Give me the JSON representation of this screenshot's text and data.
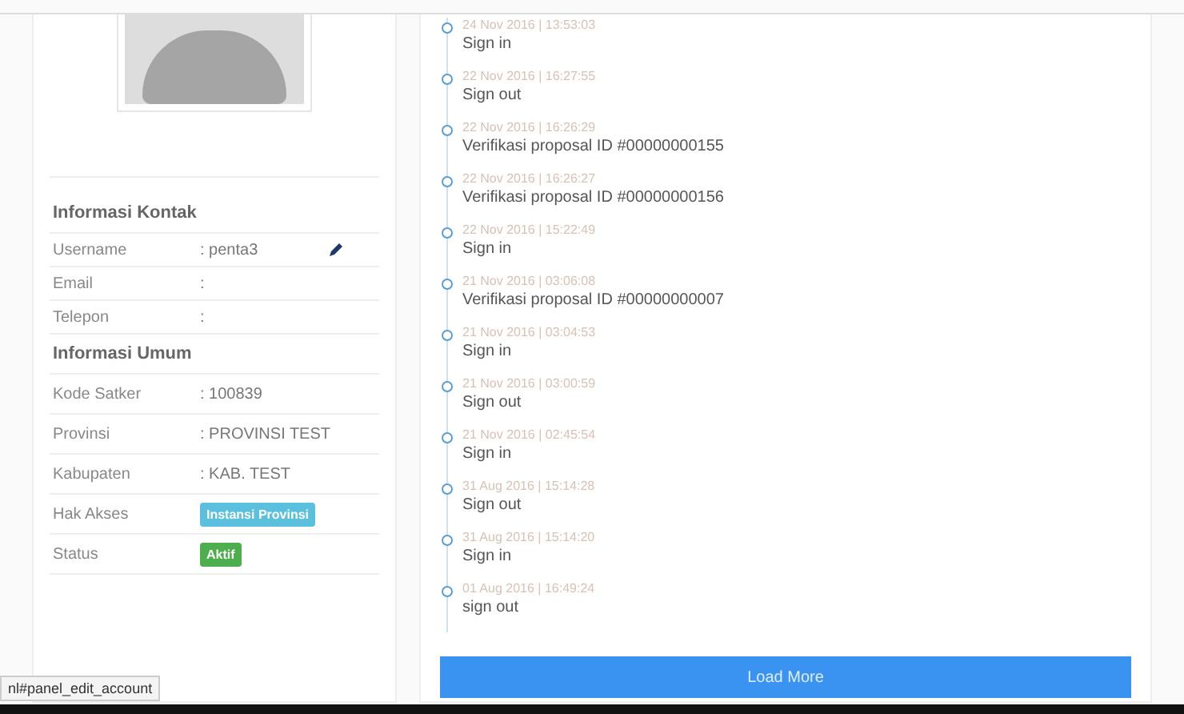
{
  "contact": {
    "title": "Informasi Kontak",
    "rows": [
      {
        "label": "Username",
        "value": ": penta3",
        "editable": true
      },
      {
        "label": "Email",
        "value": ":",
        "editable": false
      },
      {
        "label": "Telepon",
        "value": ":",
        "editable": false
      }
    ]
  },
  "general": {
    "title": "Informasi Umum",
    "rows": [
      {
        "label": "Kode Satker",
        "kind": "text",
        "value": ": 100839"
      },
      {
        "label": "Provinsi",
        "kind": "text",
        "value": ": PROVINSI TEST"
      },
      {
        "label": "Kabupaten",
        "kind": "text",
        "value": ": KAB. TEST"
      },
      {
        "label": "Hak Akses",
        "kind": "badge",
        "value": "Instansi Provinsi",
        "color": "#5bc0de"
      },
      {
        "label": "Status",
        "kind": "badge",
        "value": "Aktif",
        "color": "#4cae4c"
      }
    ]
  },
  "activity": [
    {
      "time": "24 Nov 2016 | 13:53:03",
      "action": "Sign in"
    },
    {
      "time": "22 Nov 2016 | 16:27:55",
      "action": "Sign out"
    },
    {
      "time": "22 Nov 2016 | 16:26:29",
      "action": "Verifikasi proposal ID #00000000155"
    },
    {
      "time": "22 Nov 2016 | 16:26:27",
      "action": "Verifikasi proposal ID #00000000156"
    },
    {
      "time": "22 Nov 2016 | 15:22:49",
      "action": "Sign in"
    },
    {
      "time": "21 Nov 2016 | 03:06:08",
      "action": "Verifikasi proposal ID #00000000007"
    },
    {
      "time": "21 Nov 2016 | 03:04:53",
      "action": "Sign in"
    },
    {
      "time": "21 Nov 2016 | 03:00:59",
      "action": "Sign out"
    },
    {
      "time": "21 Nov 2016 | 02:45:54",
      "action": "Sign in"
    },
    {
      "time": "31 Aug 2016 | 15:14:28",
      "action": "Sign out"
    },
    {
      "time": "31 Aug 2016 | 15:14:20",
      "action": "Sign in"
    },
    {
      "time": "01 Aug 2016 | 16:49:24",
      "action": "sign out"
    }
  ],
  "load_more": "Load More",
  "status_bar": {
    "url": "nl#panel_edit_account"
  }
}
